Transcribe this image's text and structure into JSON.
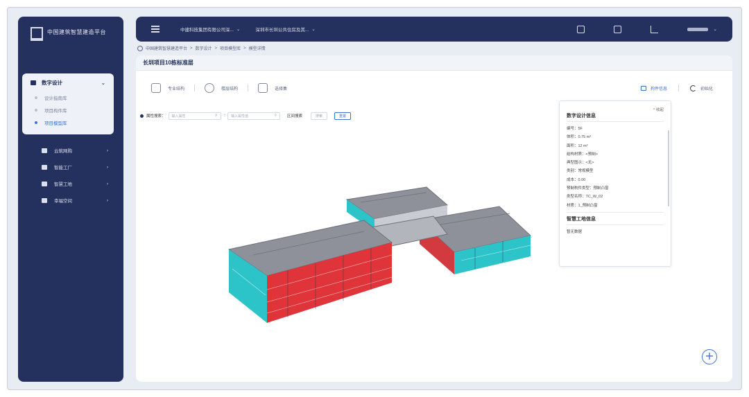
{
  "app": {
    "title": "中国建筑智慧建造平台"
  },
  "sidebar": {
    "group": {
      "label": "数字设计",
      "items": [
        {
          "label": "设计指南库",
          "active": false
        },
        {
          "label": "项目构件库",
          "active": false
        },
        {
          "label": "项目模型库",
          "active": true
        }
      ]
    },
    "items": [
      {
        "label": "云筑网购"
      },
      {
        "label": "智能工厂"
      },
      {
        "label": "智慧工地"
      },
      {
        "label": "幸福空间"
      }
    ]
  },
  "topbar": {
    "org_select": "中建科技集团有限公司深...",
    "project_select": "深圳市长圳公共住房及其..."
  },
  "breadcrumb": [
    "中国建筑智慧建造平台",
    "数字设计",
    "项目模型库",
    "模型详情"
  ],
  "page": {
    "title": "长圳项目10栋标准层"
  },
  "toolbar": {
    "tool1": "专业结构",
    "tool2": "楼层结构",
    "tool3": "选择集",
    "info_label": "构件信息",
    "reset_label": "初始化"
  },
  "search": {
    "attr_label": "属性搜索：",
    "attr_placeholder": "输入属性",
    "value_placeholder": "输入属性值",
    "range_label": "区间搜索",
    "search_button": "搜索",
    "reset_button": "重置"
  },
  "info_panel": {
    "collapse": "收起",
    "title": "数字设计信息",
    "rows": [
      "编号：5F",
      "体积：0.75 m³",
      "面积：12 m²",
      "结构材质：<预制>",
      "典型图示：<无>",
      "类别：常规模型",
      "成本：0.00",
      "预制构件类型：预制凸窗",
      "类型名称：TC_W_02",
      "材质：1_预制凸窗"
    ],
    "section2_title": "智慧工地信息",
    "section2_text": "暂无数据"
  },
  "colors": {
    "navy": "#24305d",
    "accent": "#3b6fd8",
    "model_red": "#e0343b",
    "model_cyan": "#2cc4c9",
    "model_gray": "#8c9098"
  }
}
